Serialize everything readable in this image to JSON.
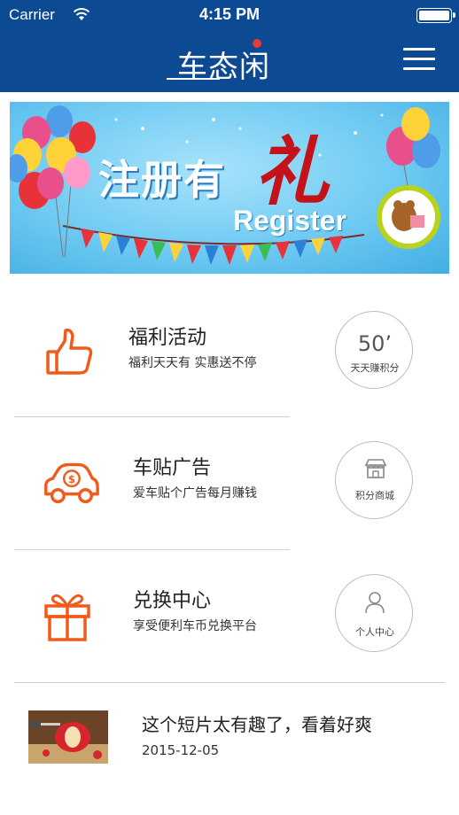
{
  "status_bar": {
    "carrier": "Carrier",
    "time": "4:15 PM",
    "wifi_icon": "wifi-icon",
    "battery_icon": "battery-icon"
  },
  "header": {
    "logo_text": "车态闲",
    "menu_icon": "hamburger-menu-icon",
    "background": "#0c4a94"
  },
  "banner": {
    "title": "注册有",
    "title_highlight": "礼",
    "subtitle": "Register"
  },
  "menu_rows": [
    {
      "title": "福利活动",
      "subtitle": "福利天天有 实惠送不停",
      "icon": "thumbs-up-icon",
      "side": {
        "value": "50’",
        "label": "天天赚积分"
      }
    },
    {
      "title": "车贴广告",
      "subtitle": "爱车贴个广告每月赚钱",
      "icon": "car-money-icon",
      "side": {
        "label": "积分商城",
        "icon": "shop-icon"
      }
    },
    {
      "title": "兑换中心",
      "subtitle": "享受便利车币兑换平台",
      "icon": "gift-icon",
      "side": {
        "label": "个人中心",
        "icon": "user-icon"
      }
    }
  ],
  "news": {
    "headline": "这个短片太有趣了，看着好爽",
    "date": "2015-12-05"
  },
  "colors": {
    "accent_orange": "#f05a1a",
    "nav_blue": "#0c4a94",
    "divider": "#d0d0d0"
  }
}
